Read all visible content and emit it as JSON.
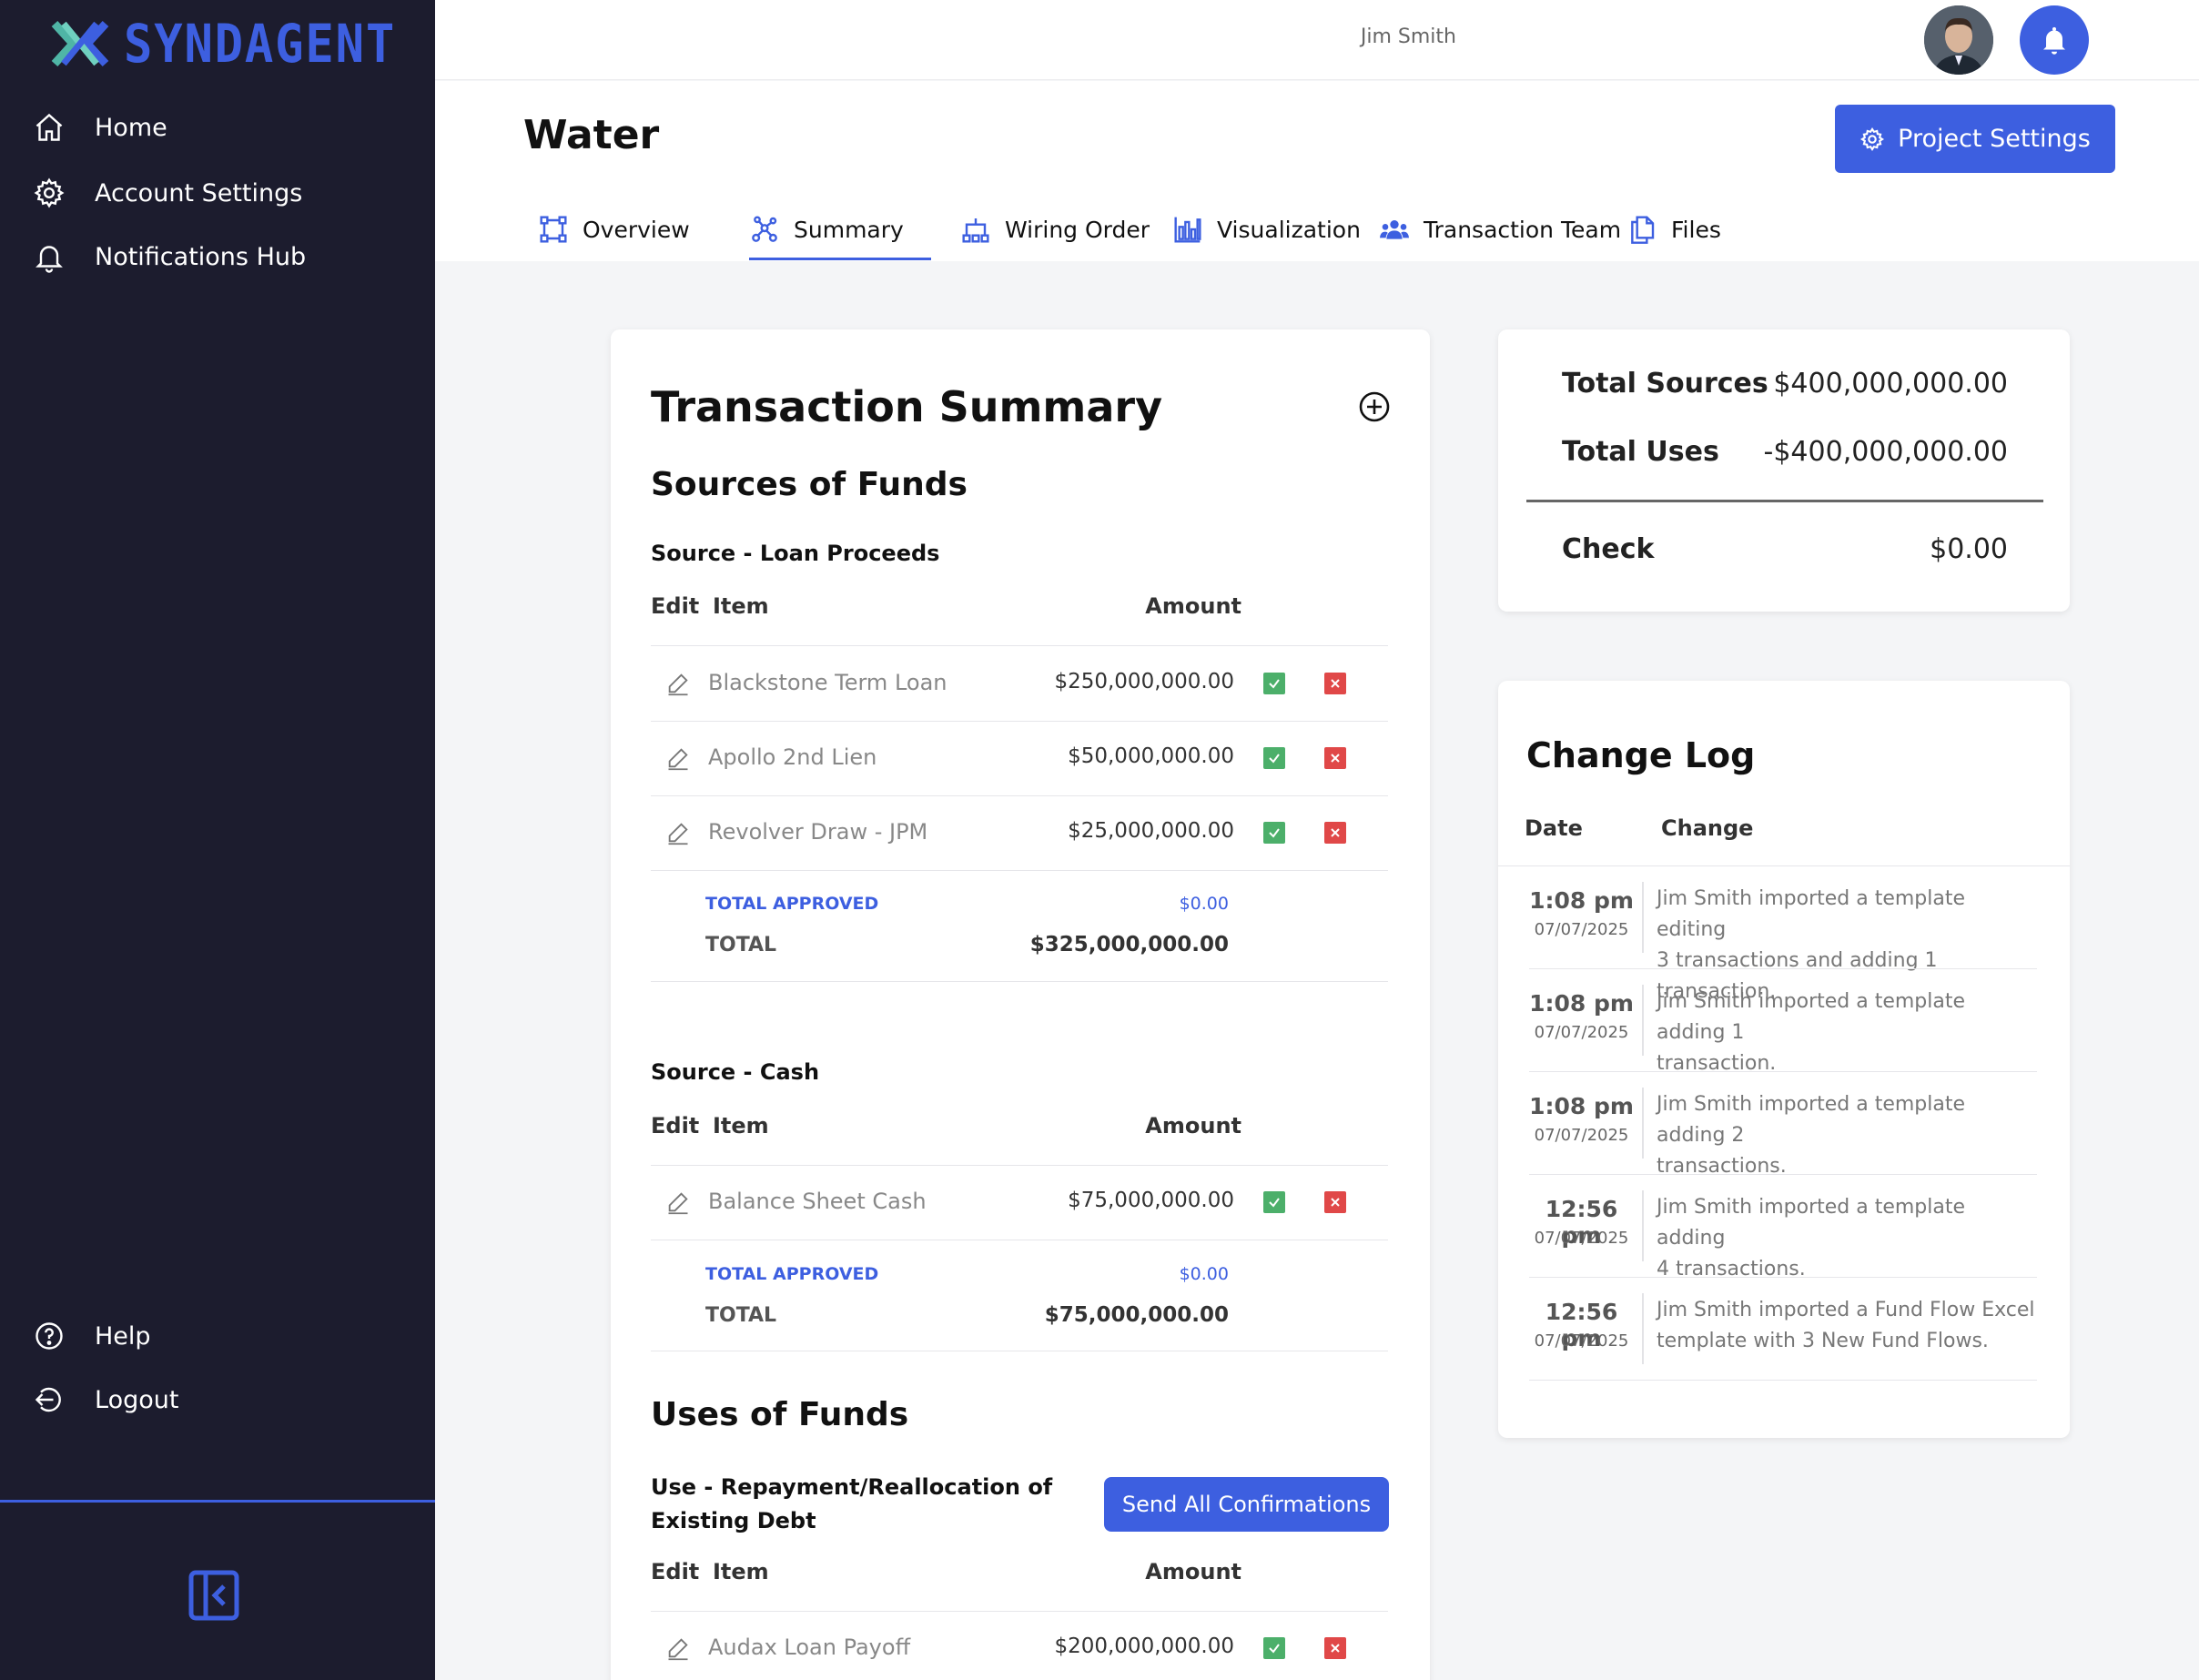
{
  "brand": {
    "name": "SYNDAGENT"
  },
  "sidebar": {
    "items": [
      {
        "label": "Home",
        "icon": "home-icon"
      },
      {
        "label": "Account Settings",
        "icon": "gear-icon"
      },
      {
        "label": "Notifications Hub",
        "icon": "bell-icon"
      }
    ],
    "bottom_items": [
      {
        "label": "Help",
        "icon": "help-icon"
      },
      {
        "label": "Logout",
        "icon": "logout-icon"
      }
    ]
  },
  "user": {
    "name": "Jim Smith"
  },
  "page": {
    "title": "Water",
    "settings_button": "Project Settings",
    "tabs": [
      {
        "label": "Overview",
        "icon": "overview-icon"
      },
      {
        "label": "Summary",
        "icon": "summary-icon",
        "active": true
      },
      {
        "label": "Wiring Order",
        "icon": "wiring-icon"
      },
      {
        "label": "Visualization",
        "icon": "chart-icon"
      },
      {
        "label": "Transaction Team",
        "icon": "team-icon"
      },
      {
        "label": "Files",
        "icon": "files-icon"
      }
    ]
  },
  "summary": {
    "title": "Transaction Summary",
    "sources_title": "Sources of Funds",
    "uses_title": "Uses of Funds",
    "columns": {
      "edit": "Edit",
      "item": "Item",
      "amount": "Amount"
    },
    "groups": [
      {
        "title": "Source - Loan Proceeds",
        "rows": [
          {
            "item": "Blackstone Term Loan",
            "amount": "$250,000,000.00"
          },
          {
            "item": "Apollo 2nd Lien",
            "amount": "$50,000,000.00"
          },
          {
            "item": "Revolver Draw - JPM",
            "amount": "$25,000,000.00"
          }
        ],
        "total_approved_label": "TOTAL APPROVED",
        "total_approved": "$0.00",
        "total_label": "TOTAL",
        "total": "$325,000,000.00"
      },
      {
        "title": "Source - Cash",
        "rows": [
          {
            "item": "Balance Sheet Cash",
            "amount": "$75,000,000.00"
          }
        ],
        "total_approved_label": "TOTAL APPROVED",
        "total_approved": "$0.00",
        "total_label": "TOTAL",
        "total": "$75,000,000.00"
      },
      {
        "title_line1": "Use - Repayment/Reallocation of",
        "title_line2": "Existing Debt",
        "button": "Send All Confirmations",
        "rows": [
          {
            "item": "Audax Loan Payoff",
            "amount": "$200,000,000.00"
          }
        ]
      }
    ]
  },
  "totals": {
    "sources_label": "Total Sources",
    "sources": "$400,000,000.00",
    "uses_label": "Total Uses",
    "uses": "-$400,000,000.00",
    "check_label": "Check",
    "check": "$0.00"
  },
  "changelog": {
    "title": "Change Log",
    "col_date": "Date",
    "col_change": "Change",
    "entries": [
      {
        "time": "1:08 pm",
        "date": "07/07/2025",
        "line1": "Jim Smith imported a template editing",
        "line2": "3 transactions and adding 1 transaction."
      },
      {
        "time": "1:08 pm",
        "date": "07/07/2025",
        "line1": "Jim Smith imported a template adding 1",
        "line2": "transaction."
      },
      {
        "time": "1:08 pm",
        "date": "07/07/2025",
        "line1": "Jim Smith imported a template adding 2",
        "line2": "transactions."
      },
      {
        "time": "12:56 pm",
        "date": "07/07/2025",
        "line1": "Jim Smith imported a template adding",
        "line2": "4 transactions."
      },
      {
        "time": "12:56 pm",
        "date": "07/07/2025",
        "line1": "Jim Smith imported a Fund Flow Excel",
        "line2": "template with 3 New Fund Flows."
      }
    ]
  },
  "colors": {
    "accent": "#3d5fe0",
    "sidebar": "#1c1c2e",
    "approve": "#4caf6a",
    "reject": "#e04848"
  }
}
